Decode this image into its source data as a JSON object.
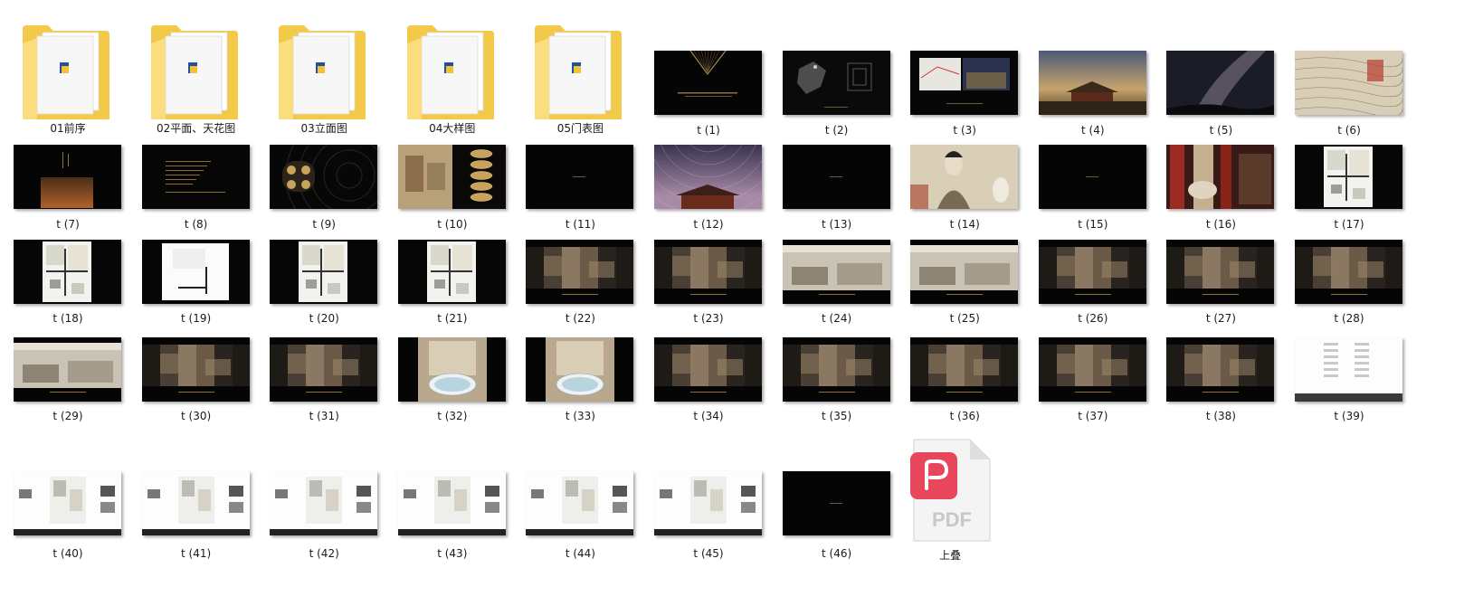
{
  "colors": {
    "folder_back": "#f3c94a",
    "folder_front": "#f9dd7e",
    "pdf_red": "#e8465a"
  },
  "folders": [
    {
      "label": "01前序",
      "icon": "folder-icon"
    },
    {
      "label": "02平面、天花图",
      "icon": "folder-icon"
    },
    {
      "label": "03立面图",
      "icon": "folder-icon"
    },
    {
      "label": "04大样图",
      "icon": "folder-icon"
    },
    {
      "label": "05门表图",
      "icon": "folder-icon"
    }
  ],
  "files": [
    {
      "label": "t (1)",
      "style": "dark-title"
    },
    {
      "label": "t (2)",
      "style": "dark-map"
    },
    {
      "label": "t (3)",
      "style": "map-photo"
    },
    {
      "label": "t (4)",
      "style": "palace-dusk"
    },
    {
      "label": "t (5)",
      "style": "milkyway"
    },
    {
      "label": "t (6)",
      "style": "old-map"
    },
    {
      "label": "t (7)",
      "style": "dark-palace"
    },
    {
      "label": "t (8)",
      "style": "dark-text"
    },
    {
      "label": "t (9)",
      "style": "dark-circles"
    },
    {
      "label": "t (10)",
      "style": "painting-ovals"
    },
    {
      "label": "t (11)",
      "style": "dark"
    },
    {
      "label": "t (12)",
      "style": "star-trails"
    },
    {
      "label": "t (13)",
      "style": "dark"
    },
    {
      "label": "t (14)",
      "style": "lady-art"
    },
    {
      "label": "t (15)",
      "style": "dark"
    },
    {
      "label": "t (16)",
      "style": "red-interior"
    },
    {
      "label": "t (17)",
      "style": "plan-dark"
    },
    {
      "label": "t (18)",
      "style": "plan-dark"
    },
    {
      "label": "t (19)",
      "style": "plan-white"
    },
    {
      "label": "t (20)",
      "style": "plan-dark"
    },
    {
      "label": "t (21)",
      "style": "plan-dark"
    },
    {
      "label": "t (22)",
      "style": "interior"
    },
    {
      "label": "t (23)",
      "style": "interior"
    },
    {
      "label": "t (24)",
      "style": "interior-light"
    },
    {
      "label": "t (25)",
      "style": "interior-light"
    },
    {
      "label": "t (26)",
      "style": "interior"
    },
    {
      "label": "t (27)",
      "style": "interior"
    },
    {
      "label": "t (28)",
      "style": "interior"
    },
    {
      "label": "t (29)",
      "style": "interior-light"
    },
    {
      "label": "t (30)",
      "style": "interior"
    },
    {
      "label": "t (31)",
      "style": "interior"
    },
    {
      "label": "t (32)",
      "style": "bath"
    },
    {
      "label": "t (33)",
      "style": "bath"
    },
    {
      "label": "t (34)",
      "style": "interior"
    },
    {
      "label": "t (35)",
      "style": "interior"
    },
    {
      "label": "t (36)",
      "style": "interior"
    },
    {
      "label": "t (37)",
      "style": "interior"
    },
    {
      "label": "t (38)",
      "style": "interior"
    },
    {
      "label": "t (39)",
      "style": "index-white"
    },
    {
      "label": "t (40)",
      "style": "board-white"
    },
    {
      "label": "t (41)",
      "style": "board-white"
    },
    {
      "label": "t (42)",
      "style": "board-white"
    },
    {
      "label": "t (43)",
      "style": "board-white"
    },
    {
      "label": "t (44)",
      "style": "board-white"
    },
    {
      "label": "t (45)",
      "style": "board-white"
    },
    {
      "label": "t (46)",
      "style": "dark"
    }
  ],
  "pdf": {
    "label": "上叠",
    "icon": "pdf-file-icon",
    "badge_text": "PDF"
  }
}
